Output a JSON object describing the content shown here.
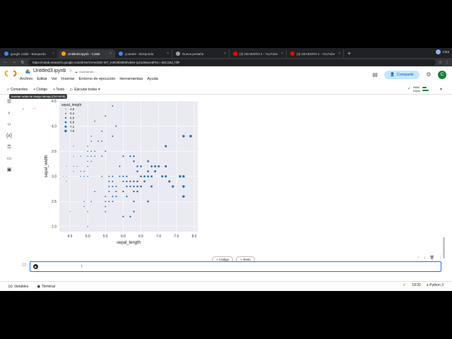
{
  "browser": {
    "tabs": [
      {
        "label": "google colab - Búsqueda",
        "active": false,
        "color": "#4285f4"
      },
      {
        "label": "Untitled3.ipynb - Colab",
        "active": true,
        "color": "#f9ab00"
      },
      {
        "label": "youtube - Búsqueda",
        "active": false,
        "color": "#4285f4"
      },
      {
        "label": "Nueva pestaña",
        "active": false,
        "color": "#9aa0a6"
      },
      {
        "label": "(3) SEABORN 4 - YouTube",
        "active": false,
        "color": "#ff0000"
      },
      {
        "label": "(3) SEABORN 4 - YouTube",
        "active": false,
        "color": "#ff0000"
      }
    ],
    "new_tab": "+",
    "profile": "Chat",
    "url": "https://colab.research.google.com/drive/1VAe2SD-W7_m0l19l25kbhv894-iyZu2MucedFlcr=-5bC33d_hfl#"
  },
  "header": {
    "title": "Untitled3.ipynb",
    "saving": "Guardando...",
    "menu": [
      "Archivo",
      "Editar",
      "Ver",
      "Insertar",
      "Entorno de ejecución",
      "Herramientas",
      "Ayuda"
    ],
    "share_label": "Compartir",
    "avatar": "C"
  },
  "toolbar": {
    "commands": "Comandos",
    "code": "+ Código",
    "text": "+ Texto",
    "run_all": "Ejecutar todas",
    "ram": "RAM",
    "disk": "Disco",
    "tooltip": "Insertar celda de código debajo (Ctrl+M+B)"
  },
  "chart_data": {
    "type": "scatter",
    "xlabel": "sepal_length",
    "ylabel": "sepal_width",
    "xlim": [
      4.2,
      8.1
    ],
    "ylim": [
      1.9,
      4.5
    ],
    "xticks": [
      "4.5",
      "5.0",
      "5.5",
      "6.0",
      "6.5",
      "7.0",
      "7.5",
      "8.0"
    ],
    "yticks": [
      "2.0",
      "2.5",
      "3.0",
      "3.5",
      "4.0",
      "4.5"
    ],
    "legend_title": "sepal_length",
    "legend": [
      "4.8",
      "5.4",
      "6.0",
      "6.6",
      "7.2",
      "7.8"
    ],
    "legend_position": "upper-left",
    "color": "#2a6fab",
    "background": "#eaeaf2",
    "points": [
      [
        4.3,
        3.0
      ],
      [
        4.4,
        2.9
      ],
      [
        4.4,
        3.0
      ],
      [
        4.4,
        3.2
      ],
      [
        4.5,
        2.3
      ],
      [
        4.6,
        3.1
      ],
      [
        4.6,
        3.4
      ],
      [
        4.6,
        3.6
      ],
      [
        4.6,
        3.2
      ],
      [
        4.7,
        3.2
      ],
      [
        4.8,
        3.4
      ],
      [
        4.8,
        3.0
      ],
      [
        4.8,
        3.1
      ],
      [
        4.9,
        3.0
      ],
      [
        4.9,
        3.1
      ],
      [
        4.9,
        2.4
      ],
      [
        4.9,
        2.5
      ],
      [
        5.0,
        3.6
      ],
      [
        5.0,
        3.4
      ],
      [
        5.0,
        3.0
      ],
      [
        5.0,
        3.3
      ],
      [
        5.0,
        3.5
      ],
      [
        5.0,
        3.2
      ],
      [
        5.0,
        2.0
      ],
      [
        5.0,
        2.3
      ],
      [
        5.1,
        3.5
      ],
      [
        5.1,
        3.8
      ],
      [
        5.1,
        3.7
      ],
      [
        5.1,
        3.3
      ],
      [
        5.1,
        3.4
      ],
      [
        5.1,
        2.5
      ],
      [
        5.2,
        3.5
      ],
      [
        5.2,
        3.4
      ],
      [
        5.2,
        4.1
      ],
      [
        5.2,
        2.7
      ],
      [
        5.3,
        3.7
      ],
      [
        5.4,
        3.9
      ],
      [
        5.4,
        3.7
      ],
      [
        5.4,
        3.4
      ],
      [
        5.4,
        3.0
      ],
      [
        5.5,
        4.2
      ],
      [
        5.5,
        3.5
      ],
      [
        5.5,
        2.3
      ],
      [
        5.5,
        2.4
      ],
      [
        5.5,
        2.6
      ],
      [
        5.5,
        2.5
      ],
      [
        5.6,
        2.9
      ],
      [
        5.6,
        3.0
      ],
      [
        5.6,
        2.5
      ],
      [
        5.6,
        2.8
      ],
      [
        5.6,
        2.7
      ],
      [
        5.7,
        4.4
      ],
      [
        5.7,
        3.8
      ],
      [
        5.7,
        2.8
      ],
      [
        5.7,
        2.6
      ],
      [
        5.7,
        3.0
      ],
      [
        5.7,
        2.9
      ],
      [
        5.7,
        2.5
      ],
      [
        5.8,
        4.0
      ],
      [
        5.8,
        2.7
      ],
      [
        5.8,
        2.6
      ],
      [
        5.8,
        2.8
      ],
      [
        5.9,
        3.0
      ],
      [
        5.9,
        3.2
      ],
      [
        6.0,
        2.2
      ],
      [
        6.0,
        2.9
      ],
      [
        6.0,
        2.7
      ],
      [
        6.0,
        3.4
      ],
      [
        6.0,
        3.0
      ],
      [
        6.1,
        2.8
      ],
      [
        6.1,
        2.9
      ],
      [
        6.1,
        3.0
      ],
      [
        6.1,
        2.6
      ],
      [
        6.2,
        2.2
      ],
      [
        6.2,
        2.9
      ],
      [
        6.2,
        3.4
      ],
      [
        6.2,
        2.8
      ],
      [
        6.3,
        3.3
      ],
      [
        6.3,
        2.5
      ],
      [
        6.3,
        2.3
      ],
      [
        6.3,
        2.9
      ],
      [
        6.3,
        2.7
      ],
      [
        6.3,
        2.8
      ],
      [
        6.3,
        3.4
      ],
      [
        6.4,
        3.2
      ],
      [
        6.4,
        2.9
      ],
      [
        6.4,
        2.7
      ],
      [
        6.4,
        2.8
      ],
      [
        6.4,
        3.1
      ],
      [
        6.5,
        2.8
      ],
      [
        6.5,
        3.0
      ],
      [
        6.5,
        3.2
      ],
      [
        6.6,
        2.9
      ],
      [
        6.6,
        3.0
      ],
      [
        6.7,
        3.1
      ],
      [
        6.7,
        3.0
      ],
      [
        6.7,
        2.5
      ],
      [
        6.7,
        3.3
      ],
      [
        6.8,
        2.8
      ],
      [
        6.8,
        3.0
      ],
      [
        6.8,
        3.2
      ],
      [
        6.9,
        3.1
      ],
      [
        6.9,
        3.2
      ],
      [
        7.0,
        3.2
      ],
      [
        7.1,
        3.0
      ],
      [
        7.2,
        3.6
      ],
      [
        7.2,
        3.2
      ],
      [
        7.2,
        3.0
      ],
      [
        7.3,
        2.9
      ],
      [
        7.4,
        2.8
      ],
      [
        7.6,
        3.0
      ],
      [
        7.7,
        3.8
      ],
      [
        7.7,
        2.6
      ],
      [
        7.7,
        2.8
      ],
      [
        7.7,
        3.0
      ],
      [
        7.9,
        3.8
      ]
    ]
  },
  "cell": {
    "add_code": "+ Código",
    "add_text": "+ Texto",
    "brackets": "[ ]"
  },
  "status": {
    "variables": "Variables",
    "terminal": "Terminal",
    "time": "19:20",
    "runtime": "Python 3"
  }
}
